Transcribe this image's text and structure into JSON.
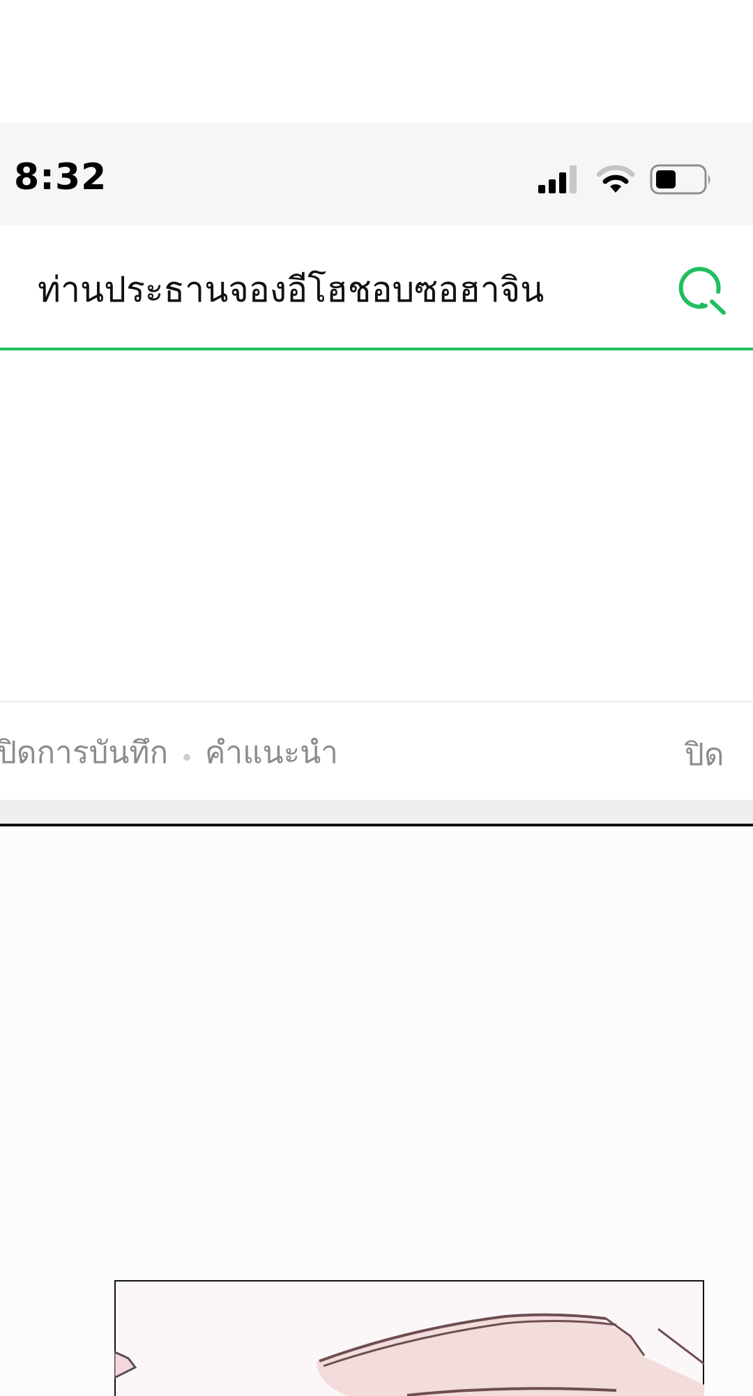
{
  "status_bar": {
    "time": "8:32",
    "icons": [
      "signal-icon",
      "wifi-icon",
      "battery-icon"
    ]
  },
  "search": {
    "query": "ท่านประธานจองอีโฮชอบซอฮาจิน",
    "icon": "search-icon",
    "accent_color": "#1fbf5e"
  },
  "history_bar": {
    "history_label": "ปิดการบันทึก",
    "recommend_label": "คำแนะนำ",
    "close_label": "ปิด"
  }
}
